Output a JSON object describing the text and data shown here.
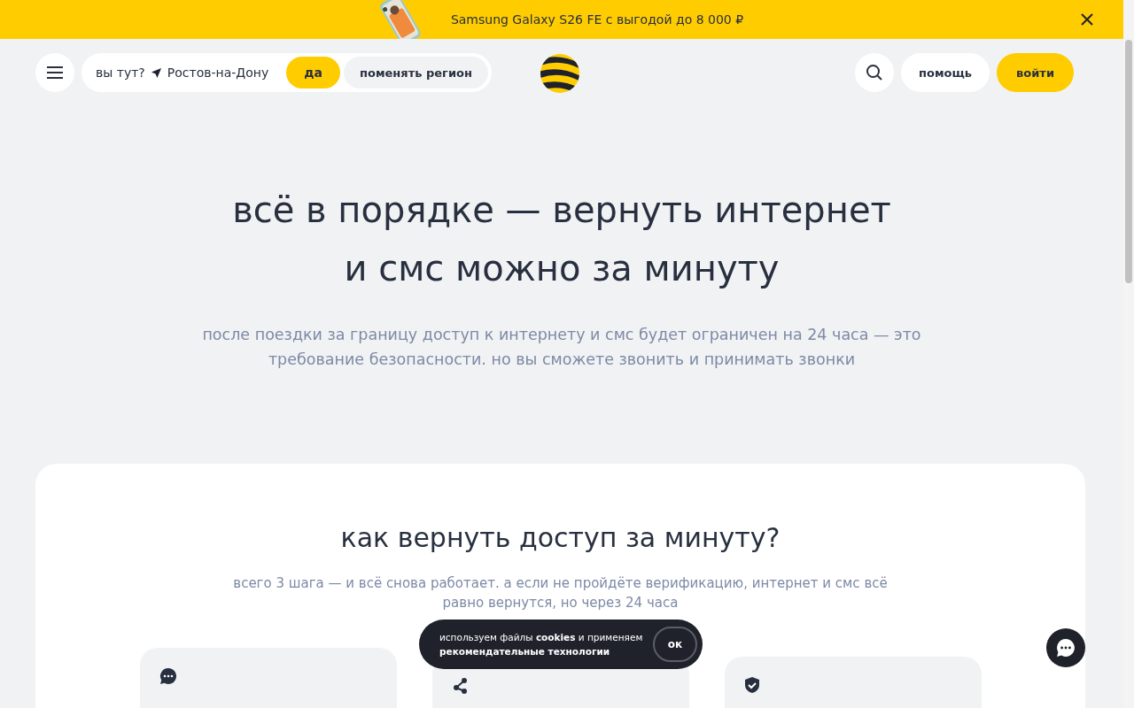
{
  "promo_bar": {
    "text": "Samsung Galaxy S26 FE с выгодой до 8 000 ₽"
  },
  "header": {
    "region_question": "вы тут?",
    "region": "Ростов-на-Дону",
    "confirm_button": "да",
    "change_button": "поменять регион",
    "help_button": "помощь",
    "login_button": "войти"
  },
  "hero": {
    "title_lines": [
      "всё в порядке — вернуть интернет",
      "и смс можно за минуту"
    ],
    "subtitle": "после поездки за границу доступ к интернету и смс будет ограничен на 24 часа — это требование безопасности. но вы сможете звонить и принимать звонки"
  },
  "steps_section": {
    "title": "как вернуть доступ за минуту?",
    "subtitle": "всего 3 шага — и всё снова работает. а если не пройдёте верификацию, интернет и смс всё равно вернутся, но через 24 часа",
    "steps": [
      {
        "kind": "chat"
      },
      {
        "kind": "share"
      },
      {
        "kind": "shield"
      }
    ]
  },
  "cookie_banner": {
    "text": "используем файлы **cookies** и применяем **рекомендательные технологии**",
    "ok_button": "ок"
  }
}
